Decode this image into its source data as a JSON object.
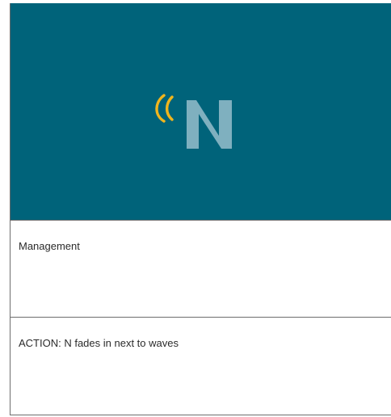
{
  "colors": {
    "preview_background": "#00637a",
    "wave_color": "#f0b51d",
    "n_color": "#7fb0bf"
  },
  "preview": {
    "icon": "wave-n-logo-icon"
  },
  "section_label": {
    "text": "Management"
  },
  "action_note": {
    "text": "ACTION: N fades in next to waves"
  }
}
